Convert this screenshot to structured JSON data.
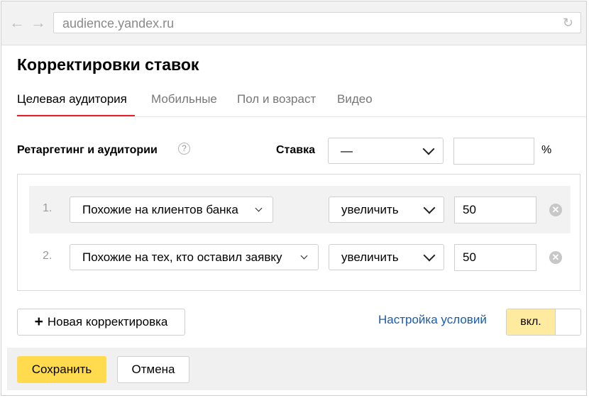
{
  "browser": {
    "url": "audience.yandex.ru"
  },
  "page": {
    "title": "Корректировки ставок"
  },
  "tabs": [
    {
      "label": "Целевая аудитория",
      "active": true
    },
    {
      "label": "Мобильные",
      "active": false
    },
    {
      "label": "Пол и возраст",
      "active": false
    },
    {
      "label": "Видео",
      "active": false
    }
  ],
  "retargeting": {
    "label": "Ретаргетинг и аудитории",
    "help_icon": "?",
    "rate_label": "Ставка",
    "rate_select_value": "—",
    "rate_input_value": "",
    "percent_sign": "%"
  },
  "rules": [
    {
      "number": "1.",
      "audience": "Похожие на клиентов банка",
      "action": "увеличить",
      "value": "50"
    },
    {
      "number": "2.",
      "audience": "Похожие на тех, кто оставил заявку",
      "action": "увеличить",
      "value": "50"
    }
  ],
  "actions": {
    "add_label": "Новая корректировка",
    "conditions_link": "Настройка условий",
    "toggle_label": "вкл.",
    "save_label": "Сохранить",
    "cancel_label": "Отмена"
  },
  "colors": {
    "accent_yellow": "#ffdb4d",
    "tab_underline": "#e4222c",
    "link": "#1a5ca8"
  }
}
